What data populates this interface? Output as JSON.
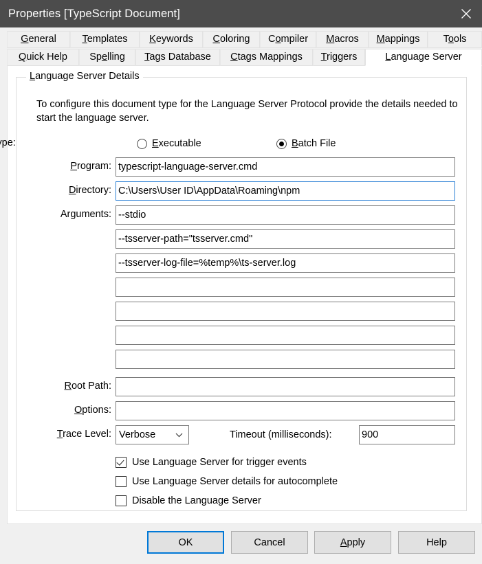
{
  "window": {
    "title": "Properties [TypeScript Document]",
    "close_icon": "close-icon",
    "titlebar_color": "#4c4c4c"
  },
  "tabs": {
    "row1": [
      {
        "label": "General",
        "mnemonic": "G",
        "selected": false
      },
      {
        "label": "Templates",
        "mnemonic": "T",
        "selected": false
      },
      {
        "label": "Keywords",
        "mnemonic": "K",
        "selected": false
      },
      {
        "label": "Coloring",
        "mnemonic": "C",
        "selected": false
      },
      {
        "label": "Compiler",
        "mnemonic": "o",
        "selected": false
      },
      {
        "label": "Macros",
        "mnemonic": "M",
        "selected": false
      },
      {
        "label": "Mappings",
        "mnemonic": "M",
        "selected": false
      },
      {
        "label": "Tools",
        "mnemonic": "o",
        "selected": false
      }
    ],
    "row2": [
      {
        "label": "Quick Help",
        "mnemonic": "Q",
        "selected": false
      },
      {
        "label": "Spelling",
        "mnemonic": "e",
        "selected": false
      },
      {
        "label": "Tags Database",
        "mnemonic": "T",
        "selected": false
      },
      {
        "label": "Ctags Mappings",
        "mnemonic": "C",
        "selected": false
      },
      {
        "label": "Triggers",
        "mnemonic": "T",
        "selected": false
      },
      {
        "label": "Language Server",
        "mnemonic": "L",
        "selected": true
      }
    ]
  },
  "group": {
    "legend_pre": "",
    "legend_mnemonic": "L",
    "legend_post": "anguage Server Details",
    "description": "To configure this document type for the Language Server Protocol provide the details needed to start the language server."
  },
  "program_type": {
    "label": "Program Type:",
    "options": [
      {
        "label_pre": "",
        "mnemonic": "E",
        "label_post": "xecutable",
        "selected": false
      },
      {
        "label_pre": "",
        "mnemonic": "B",
        "label_post": "atch File",
        "selected": true
      }
    ]
  },
  "fields": {
    "program": {
      "label_mnemonic": "P",
      "label_post": "rogram:",
      "value": "typescript-language-server.cmd",
      "focused": false
    },
    "directory": {
      "label_mnemonic": "D",
      "label_post": "irectory:",
      "value": "C:\\Users\\User ID\\AppData\\Roaming\\npm",
      "focused": true
    },
    "arguments": {
      "label": "Arguments:",
      "values": [
        "--stdio",
        "--tsserver-path=\"tsserver.cmd\"",
        "--tsserver-log-file=%temp%\\ts-server.log",
        "",
        "",
        "",
        ""
      ]
    },
    "root_path": {
      "label_mnemonic": "R",
      "label_post": "oot Path:",
      "value": ""
    },
    "options": {
      "label_mnemonic": "O",
      "label_post": "ptions:",
      "value": ""
    },
    "trace_level": {
      "label_mnemonic": "T",
      "label_post": "race Level:",
      "value": "Verbose",
      "arrow_icon": "chevron-down-icon"
    },
    "timeout": {
      "label": "Timeout (milliseconds):",
      "value": "900"
    }
  },
  "checkboxes": [
    {
      "label": "Use Language Server for trigger events",
      "checked": true
    },
    {
      "label": "Use Language Server details for autocomplete",
      "checked": false
    },
    {
      "label": "Disable the Language Server",
      "checked": false
    }
  ],
  "buttons": [
    {
      "label": "OK",
      "mnemonic": "",
      "default": true
    },
    {
      "label": "Cancel",
      "mnemonic": "",
      "default": false
    },
    {
      "label_pre": "",
      "mnemonic": "A",
      "label_post": "pply",
      "label": "Apply",
      "default": false
    },
    {
      "label": "Help",
      "mnemonic": "",
      "default": false
    }
  ],
  "colors": {
    "accent": "#0078d7",
    "focus_border": "#2a7fd4",
    "titlebar": "#4c4c4c",
    "dialog_bg": "#f0f0f0",
    "page_bg": "#ffffff"
  }
}
